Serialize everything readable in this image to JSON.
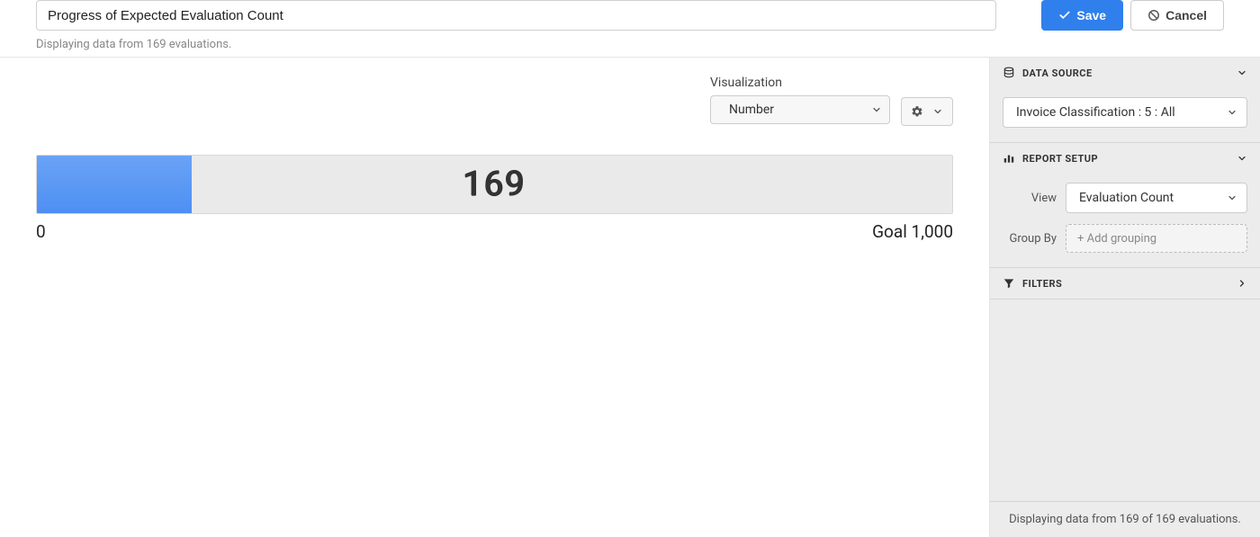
{
  "header": {
    "title_value": "Progress of Expected Evaluation Count",
    "subtitle": "Displaying data from 169 evaluations.",
    "save_label": "Save",
    "cancel_label": "Cancel"
  },
  "visualization": {
    "label": "Visualization",
    "selected": "Number"
  },
  "chart_data": {
    "type": "bar",
    "value": 169,
    "min": 0,
    "goal": 1000,
    "min_label": "0",
    "goal_label": "Goal 1,000",
    "value_label": "169",
    "fill_percent": 16.9
  },
  "sidebar": {
    "data_source": {
      "title": "DATA SOURCE",
      "selected": "Invoice Classification : 5 : All"
    },
    "report_setup": {
      "title": "REPORT SETUP",
      "view_label": "View",
      "view_selected": "Evaluation Count",
      "group_by_label": "Group By",
      "add_grouping_label": "+ Add grouping"
    },
    "filters": {
      "title": "FILTERS"
    },
    "footer": "Displaying data from 169 of 169 evaluations."
  }
}
